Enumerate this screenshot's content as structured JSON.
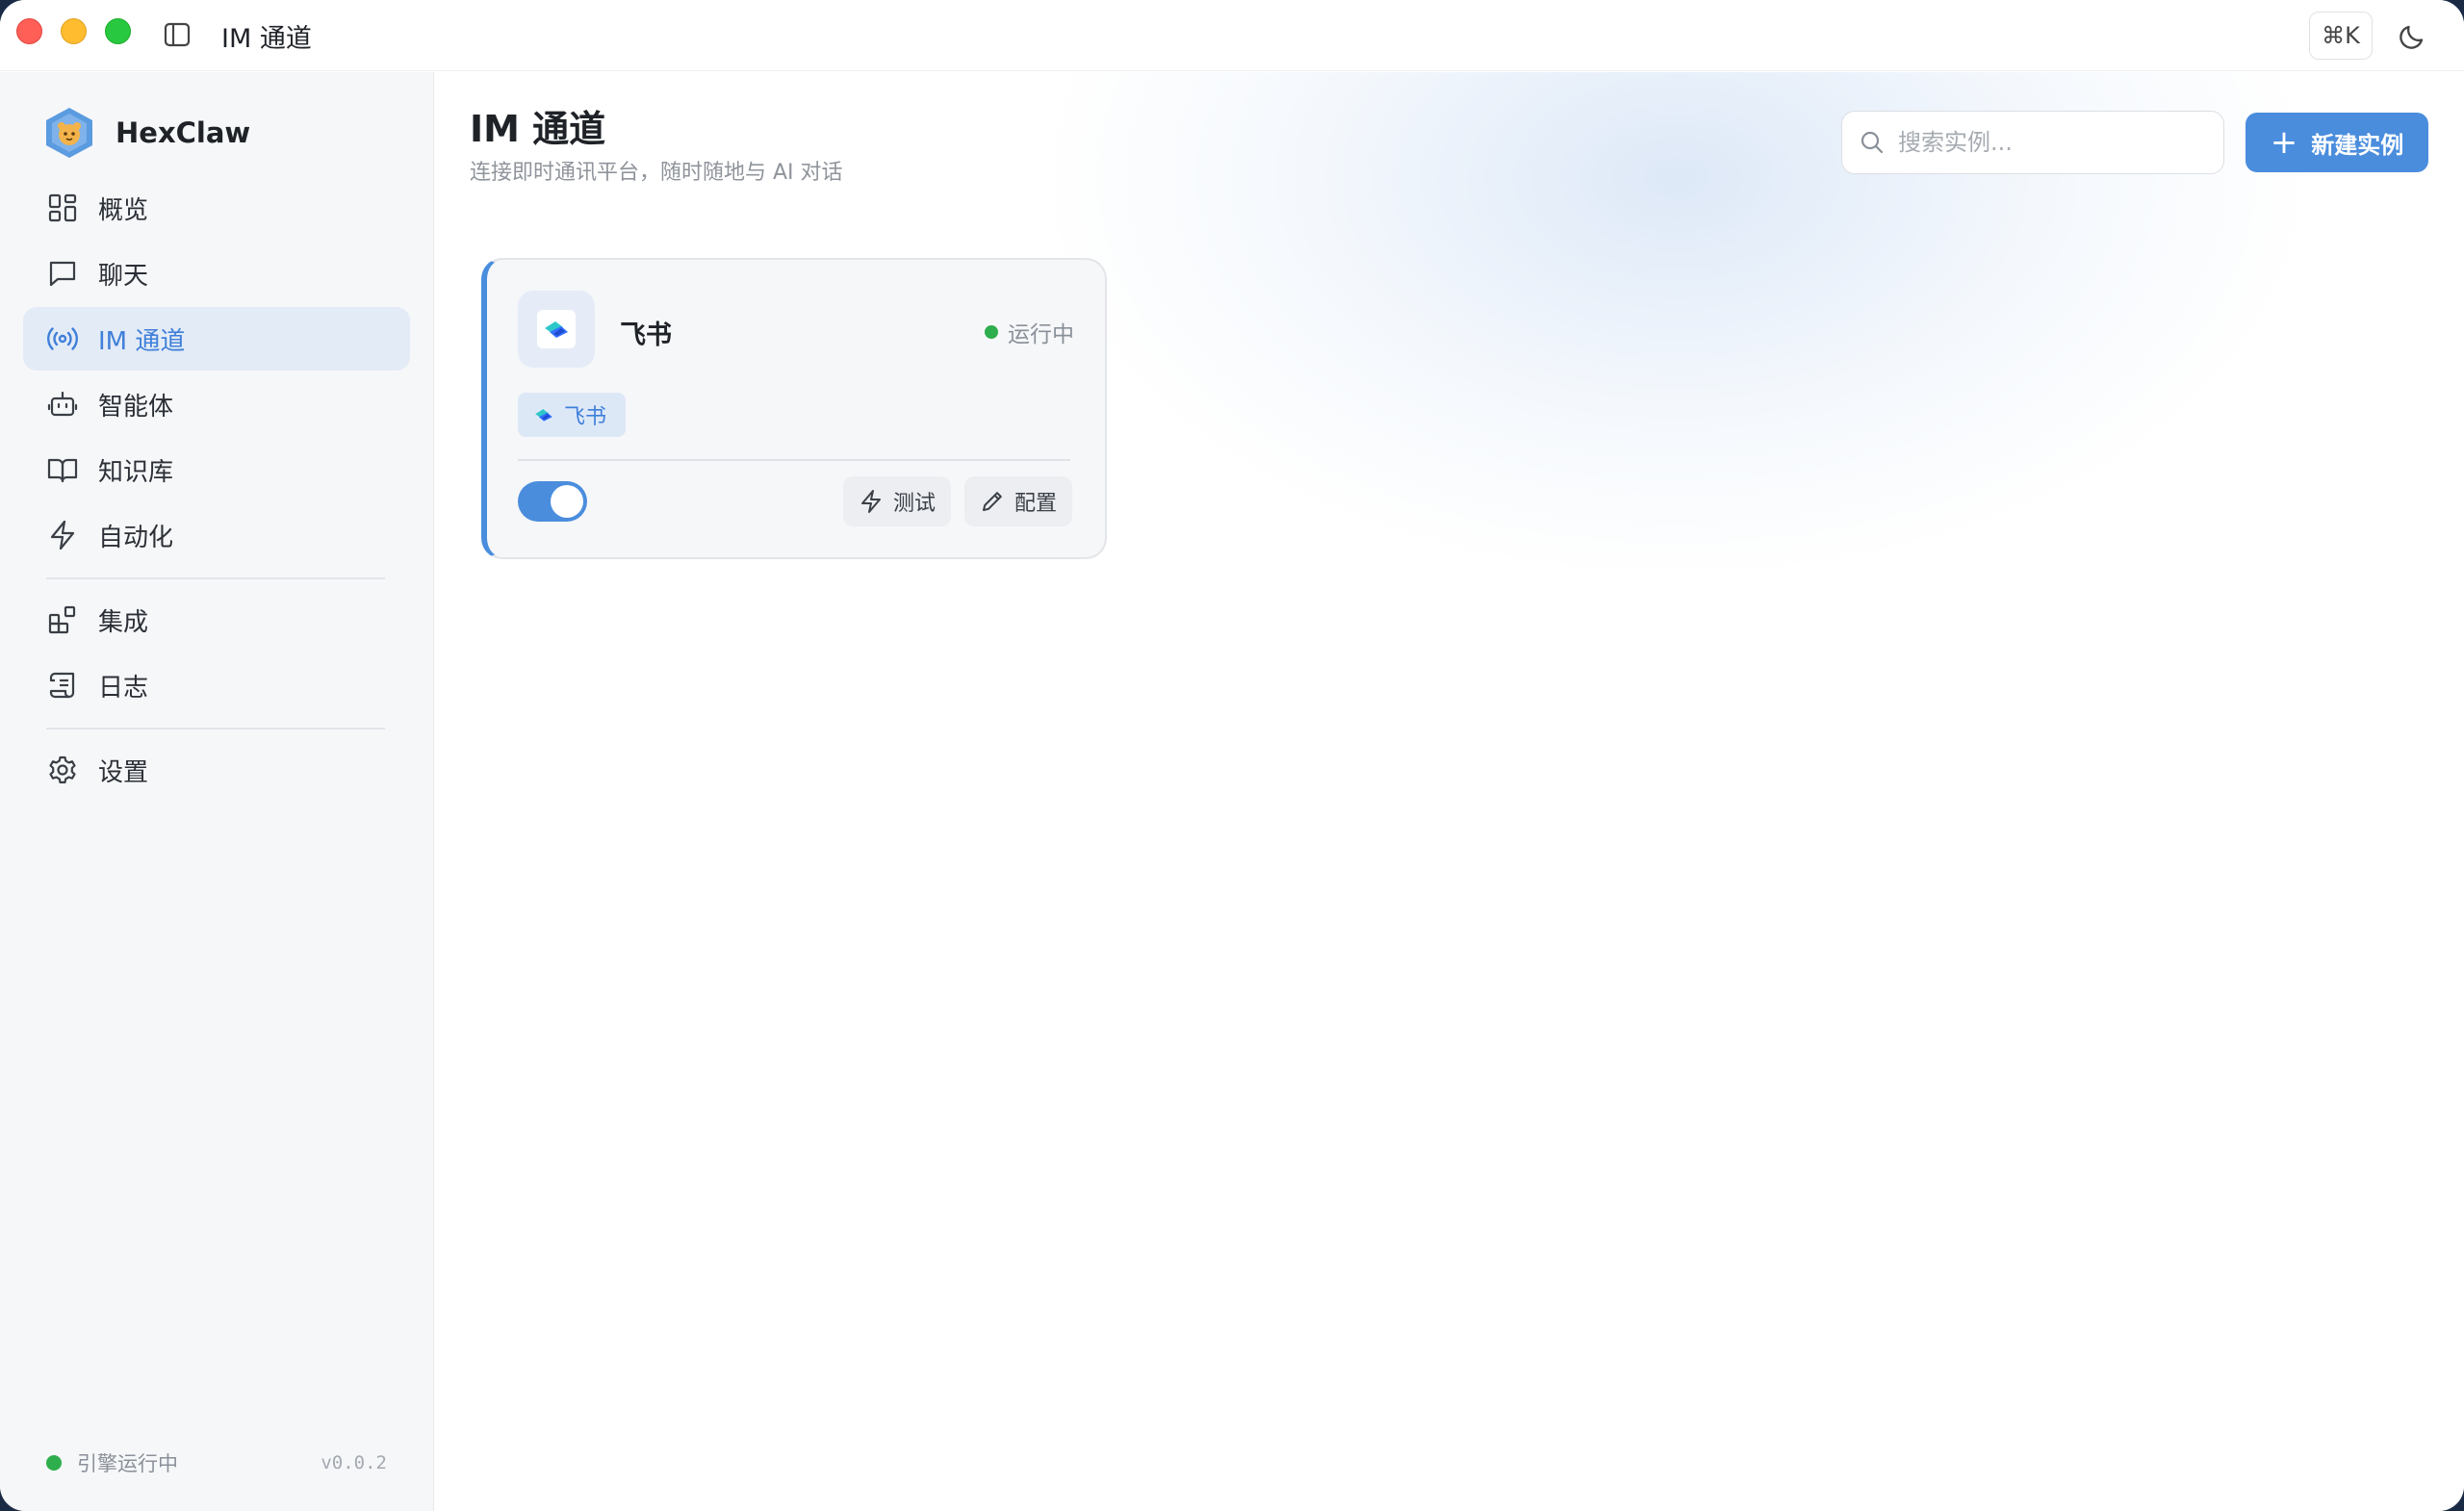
{
  "window": {
    "title": "IM 通道",
    "shortcut_label": "⌘K"
  },
  "sidebar": {
    "brand": "HexClaw",
    "items": [
      {
        "label": "概览",
        "icon": "dashboard-icon"
      },
      {
        "label": "聊天",
        "icon": "chat-icon"
      },
      {
        "label": "IM 通道",
        "icon": "broadcast-icon",
        "active": true
      },
      {
        "label": "智能体",
        "icon": "robot-icon"
      },
      {
        "label": "知识库",
        "icon": "book-icon"
      },
      {
        "label": "自动化",
        "icon": "lightning-icon"
      },
      {
        "label": "集成",
        "icon": "integration-icon"
      },
      {
        "label": "日志",
        "icon": "scroll-icon"
      },
      {
        "label": "设置",
        "icon": "gear-icon"
      }
    ],
    "footer": {
      "status": "引擎运行中",
      "version": "v0.0.2"
    }
  },
  "main": {
    "title": "IM 通道",
    "subtitle": "连接即时通讯平台，随时随地与 AI 对话",
    "search": {
      "placeholder": "搜索实例..."
    },
    "new_button": {
      "label": "新建实例"
    },
    "instances": [
      {
        "name": "飞书",
        "status": "运行中",
        "tag": "飞书",
        "enabled": true,
        "test_label": "测试",
        "config_label": "配置"
      }
    ]
  },
  "colors": {
    "accent": "#4a8ddd",
    "status_green": "#2fae4d",
    "active_nav_bg": "#e3ebf6"
  }
}
